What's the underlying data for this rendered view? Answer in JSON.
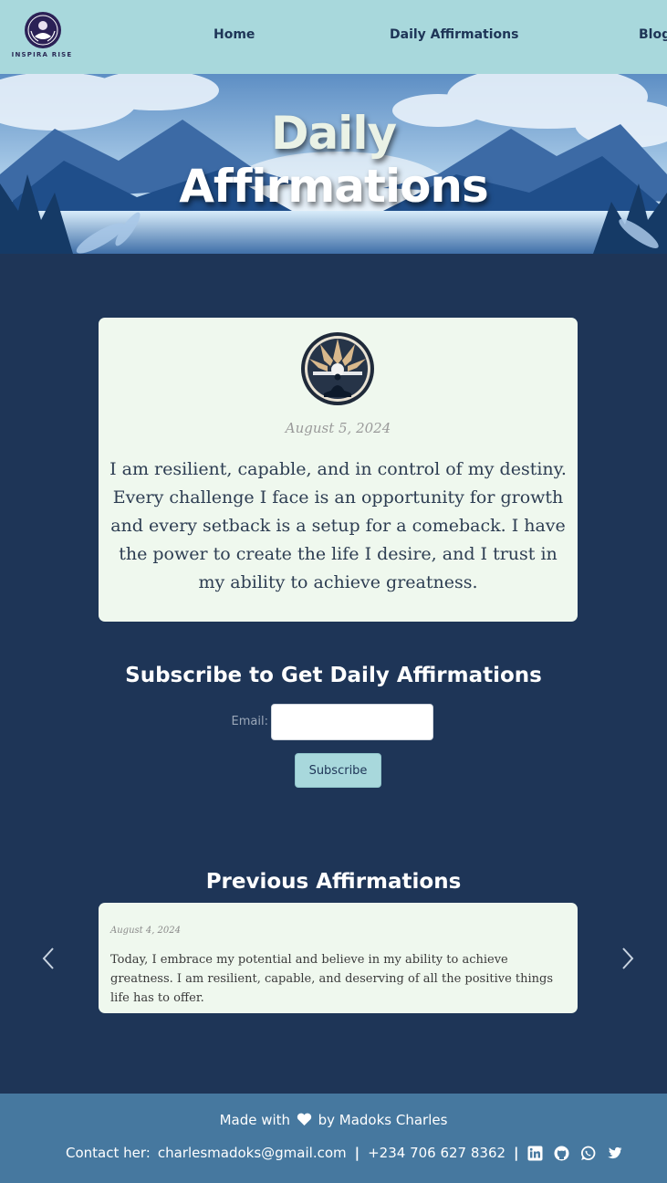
{
  "header": {
    "logo_text": "INSPIRA RISE",
    "nav": [
      {
        "label": "Home"
      },
      {
        "label": "Daily Affirmations"
      },
      {
        "label": "Blog"
      }
    ]
  },
  "hero": {
    "title_line1": "Daily",
    "title_line2": "Affirmations"
  },
  "today": {
    "date": "August 5, 2024",
    "text": "I am resilient, capable, and in control of my destiny. Every challenge I face is an opportunity for growth and every setback is a setup for a comeback. I have the power to create the life I desire, and I trust in my ability to achieve greatness."
  },
  "subscribe": {
    "title": "Subscribe to Get Daily Affirmations",
    "email_label": "Email:",
    "email_value": "",
    "button_label": "Subscribe"
  },
  "previous": {
    "title": "Previous Affirmations",
    "items": [
      {
        "date": "August 4, 2024",
        "text": "Today, I embrace my potential and believe in my ability to achieve greatness. I am resilient, capable, and deserving of all the positive things life has to offer."
      }
    ]
  },
  "footer": {
    "made_prefix": "Made with",
    "made_suffix": "by Madoks Charles",
    "contact_label": "Contact her:",
    "email": "charlesmadoks@gmail.com",
    "separator": "|",
    "phone": "+234 706 627 8362",
    "socials": [
      "linkedin-icon",
      "github-icon",
      "whatsapp-icon",
      "twitter-icon"
    ]
  },
  "colors": {
    "header_bg": "#a8d8dc",
    "page_bg": "#1e3557",
    "card_bg": "#eff8ee",
    "footer_bg": "#46789f"
  }
}
